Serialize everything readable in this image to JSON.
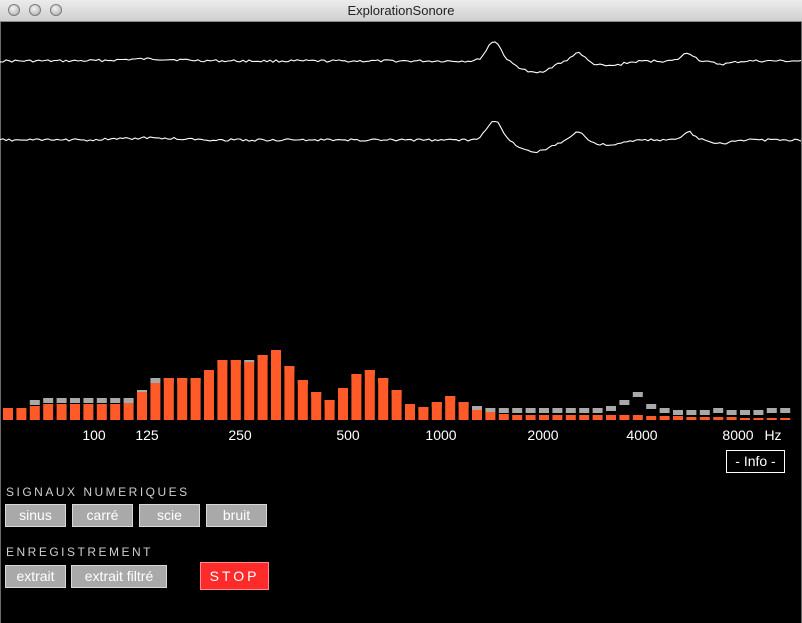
{
  "window": {
    "title": "ExplorationSonore"
  },
  "spectrum": {
    "frequency_labels": [
      "100",
      "125",
      "250",
      "500",
      "1000",
      "2000",
      "4000",
      "8000"
    ],
    "unit": "Hz",
    "bar_color": "#ff5a28",
    "peak_color": "#a9a9a9"
  },
  "info_button": "- Info -",
  "signals": {
    "title": "SIGNAUX NUMERIQUES",
    "buttons": [
      "sinus",
      "carré",
      "scie",
      "bruit"
    ]
  },
  "recording": {
    "title": "ENREGISTREMENT",
    "buttons": [
      "extrait",
      "extrait filtré"
    ],
    "stop": "STOP"
  }
}
